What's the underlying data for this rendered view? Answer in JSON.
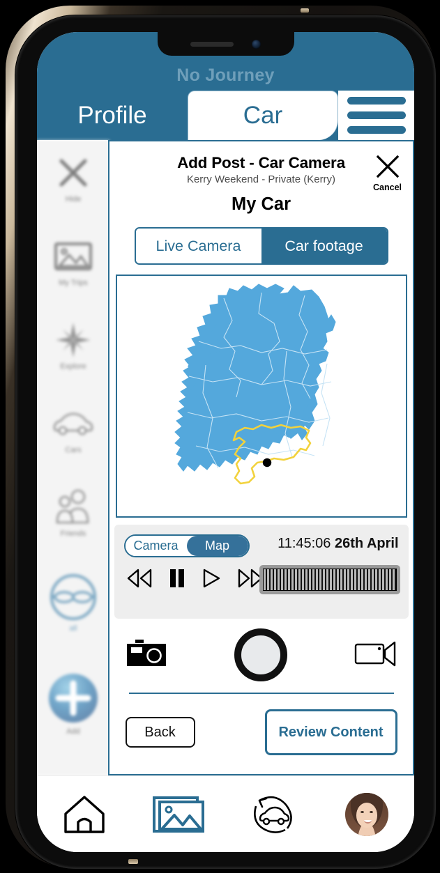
{
  "header": {
    "journey_status": "No Journey",
    "tabs": [
      {
        "label": "Profile",
        "active": false
      },
      {
        "label": "Car",
        "active": true
      }
    ],
    "menu_icon": "hamburger-menu-icon"
  },
  "sidebar": {
    "items": [
      {
        "label": "Hide",
        "icon": "close-x-icon"
      },
      {
        "label": "My Trips",
        "icon": "photo-gallery-icon"
      },
      {
        "label": "Explore",
        "icon": "compass-icon"
      },
      {
        "label": "Cars",
        "icon": "car-icon"
      },
      {
        "label": "Friends",
        "icon": "people-icon"
      },
      {
        "label": "all",
        "icon": "glasses-circle-icon"
      },
      {
        "label": "Add",
        "icon": "plus-circle-icon"
      }
    ]
  },
  "modal": {
    "title": "Add Post - Car Camera",
    "subtitle": "Kerry Weekend - Private (Kerry)",
    "car_name": "My Car",
    "cancel_label": "Cancel",
    "cancel_icon": "close-x-icon",
    "source_toggle": {
      "options": [
        {
          "label": "Live Camera",
          "selected": false
        },
        {
          "label": "Car footage",
          "selected": true
        }
      ]
    },
    "map": {
      "region": "Ireland",
      "fill_color": "#54a8dc",
      "border_color": "#bfe0f3",
      "route_color": "#f2d23c",
      "marker_color": "#000000",
      "marker_label": "current-location-marker"
    },
    "playback": {
      "view_toggle": {
        "options": [
          {
            "label": "Camera",
            "selected": false
          },
          {
            "label": "Map",
            "selected": true
          }
        ]
      },
      "timestamp_time": "11:45:06",
      "timestamp_date": "26th April",
      "controls": [
        {
          "name": "rewind-button",
          "icon": "rewind-icon"
        },
        {
          "name": "pause-button",
          "icon": "pause-icon"
        },
        {
          "name": "play-button",
          "icon": "play-icon"
        },
        {
          "name": "fast-forward-button",
          "icon": "fast-forward-icon"
        }
      ],
      "scrubber_name": "film-strip-scrubber"
    },
    "capture": {
      "photo_icon": "camera-icon",
      "shutter_name": "shutter-button",
      "video_icon": "video-camera-icon"
    },
    "footer": {
      "back_label": "Back",
      "review_label": "Review Content"
    }
  },
  "bottom_nav": {
    "items": [
      {
        "name": "home",
        "icon": "home-icon",
        "active": false
      },
      {
        "name": "gallery",
        "icon": "photo-gallery-icon",
        "active": true
      },
      {
        "name": "car-sync",
        "icon": "car-refresh-icon",
        "active": false
      },
      {
        "name": "profile",
        "icon": "avatar-icon",
        "active": false
      }
    ]
  },
  "colors": {
    "brand_blue": "#2a6d92",
    "map_blue": "#54a8dc",
    "route_yellow": "#f2d23c",
    "panel_gray": "#eeeeee"
  }
}
